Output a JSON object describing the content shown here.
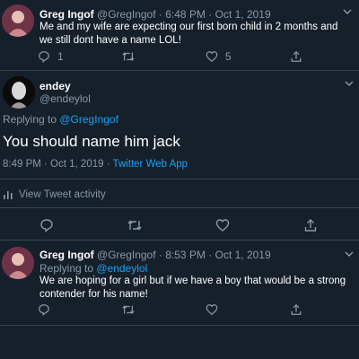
{
  "tweet1": {
    "name": "Greg Ingof",
    "handle": "@GregIngof",
    "time": "· 6:48 PM · Oct 1, 2019",
    "text": "Me and my wife are expecting our first born child in 2 months and we still dont have a name LOL!",
    "actions": {
      "reply": "1",
      "retweet": "",
      "like": "5"
    }
  },
  "main": {
    "name": "endey",
    "handle": "@endeylol",
    "replying_prefix": "Replying to ",
    "replying_handle": "@GregIngof",
    "text": "You should name him jack",
    "time": "8:49 PM · Oct 1, 2019 · ",
    "source": "Twitter Web App",
    "activity": "View Tweet activity"
  },
  "tweet3": {
    "name": "Greg Ingof",
    "handle": "@GregIngof",
    "time": "· 8:53 PM · Oct 1, 2019",
    "replying_prefix": "Replying to ",
    "replying_handle": "@endeylol",
    "text": "We are hoping for a girl but if we have a boy that would be a strong contender for his name!"
  },
  "colors": {
    "background": "#15202b",
    "muted": "#8899a6",
    "link": "#1da1f2",
    "divider": "#38444d"
  },
  "icons": [
    "reply-icon",
    "retweet-icon",
    "like-icon",
    "share-icon",
    "chevron-down-icon",
    "activity-icon"
  ]
}
